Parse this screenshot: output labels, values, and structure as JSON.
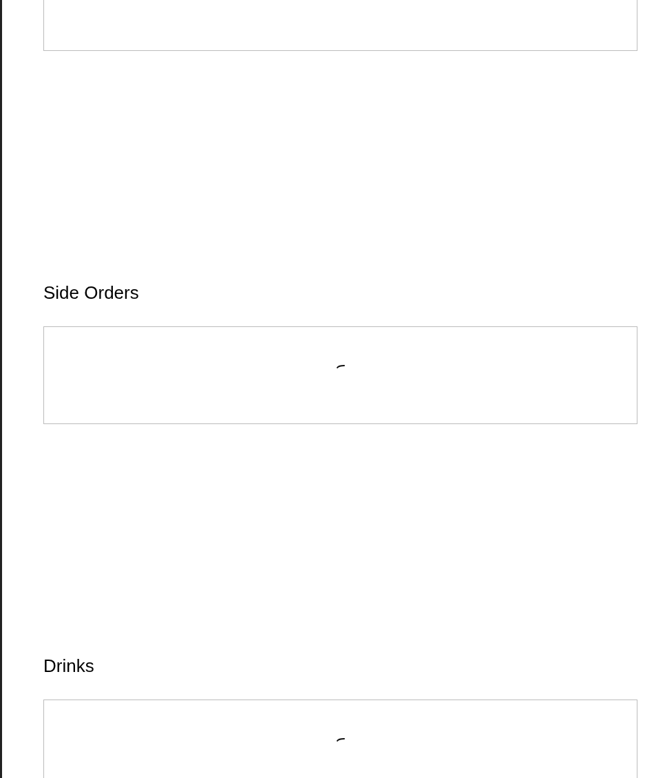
{
  "sections": [
    {
      "loading": false
    },
    {
      "title": "Side Orders",
      "loading": true
    },
    {
      "title": "Drinks",
      "loading": true
    }
  ]
}
